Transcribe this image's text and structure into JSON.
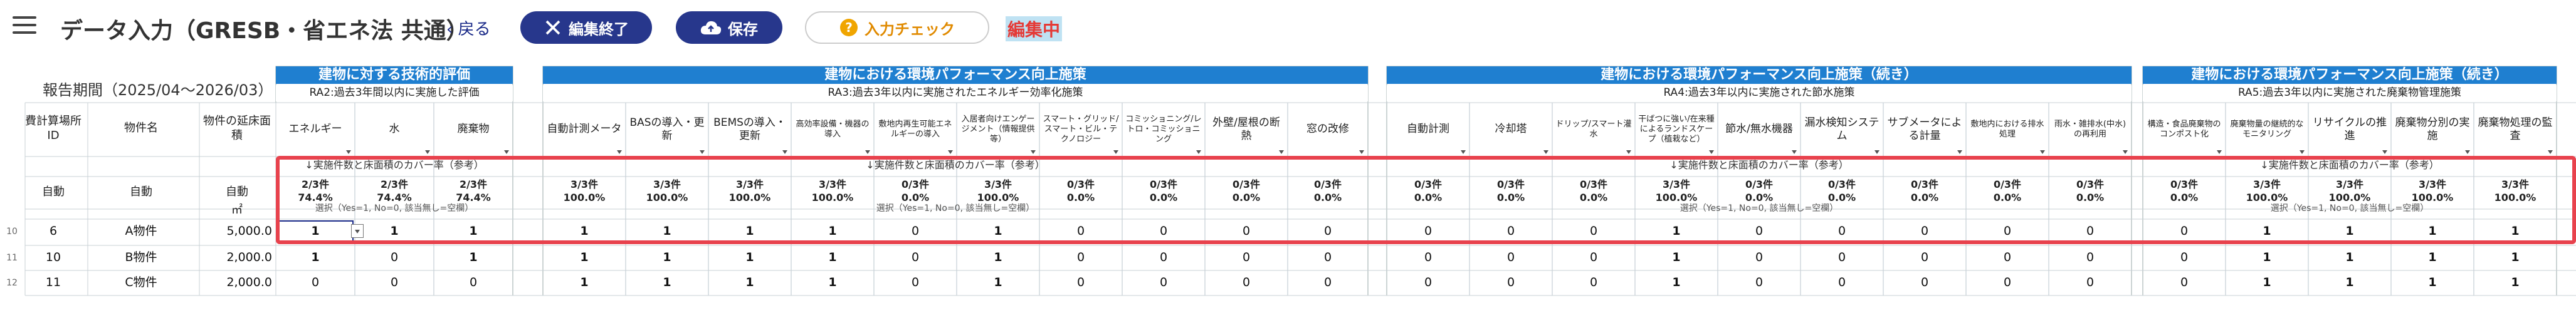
{
  "topbar": {
    "title": "データ入力（GRESB・省エネ法 共通）",
    "back_label": "戻る",
    "end_edit_label": "編集終了",
    "save_label": "保存",
    "check_label": "入力チェック",
    "edit_status": "編集中",
    "accent": "#27378c"
  },
  "sheet": {
    "period": "報告期間（2025/04～2026/03）",
    "left_headers": {
      "id": "費計算場所ID",
      "name": "物件名",
      "area": "物件の延床面積"
    },
    "left_auto": {
      "id": "自動",
      "name": "自動",
      "area": "自動"
    },
    "area_unit": "㎡",
    "sections": [
      {
        "title": "建物に対する技術的評価",
        "subtitle": "RA2:過去3年間以内に実施した評価",
        "note": "↓実施件数と床面積のカバー率（参考）",
        "items": [
          "エネルギー",
          "水",
          "廃棄物"
        ]
      },
      {
        "title": "建物における環境パフォーマンス向上施策",
        "subtitle": "RA3:過去3年以内に実施されたエネルギー効率化施策",
        "note": "↓実施件数と床面積のカバー率（参考）",
        "items": [
          "自動計測メータ",
          "BASの導入・更新",
          "BEMSの導入・更新",
          "高効率設備・機器の導入",
          "敷地内再生可能エネルギーの導入",
          "入居者向けエンゲージメント（情報提供等）",
          "スマート・グリッド/スマート・ビル・テクノロジー",
          "コミッショニング/レトロ・コミッショニング",
          "外壁/屋根の断熱",
          "窓の改修"
        ]
      },
      {
        "title": "建物における環境パフォーマンス向上施策（続き）",
        "subtitle": "RA4:過去3年以内に実施された節水施策",
        "note": "↓実施件数と床面積のカバー率（参考）",
        "items": [
          "自動計測",
          "冷却塔",
          "ドリップ/スマート灌水",
          "干ばつに強い/在来種によるランドスケープ（植栽など）",
          "節水/無水機器",
          "漏水検知システム",
          "サブメータによる計量",
          "敷地内における排水処理",
          "雨水・雑排水(中水)の再利用"
        ]
      },
      {
        "title": "建物における環境パフォーマンス向上施策（続き）",
        "subtitle": "RA5:過去3年以内に実施された廃棄物管理施策",
        "note": "↓実施件数と床面積のカバー率（参考）",
        "items": [
          "構造・食品廃棄物のコンポスト化",
          "廃棄物量の継続的なモニタリング",
          "リサイクルの推進",
          "廃棄物分別の実施",
          "廃棄物処理の監査"
        ]
      }
    ],
    "coverage": [
      [
        "2/3件",
        "2/3件",
        "2/3件"
      ],
      [
        "3/3件",
        "3/3件",
        "3/3件",
        "3/3件",
        "0/3件",
        "3/3件",
        "0/3件",
        "0/3件",
        "0/3件",
        "0/3件"
      ],
      [
        "0/3件",
        "0/3件",
        "0/3件",
        "3/3件",
        "0/3件",
        "0/3件",
        "0/3件",
        "0/3件",
        "0/3件"
      ],
      [
        "0/3件",
        "3/3件",
        "3/3件",
        "3/3件",
        "3/3件"
      ]
    ],
    "coverage_pct": [
      [
        "74.4%",
        "74.4%",
        "74.4%"
      ],
      [
        "100.0%",
        "100.0%",
        "100.0%",
        "100.0%",
        "0.0%",
        "100.0%",
        "0.0%",
        "0.0%",
        "0.0%",
        "0.0%"
      ],
      [
        "0.0%",
        "0.0%",
        "0.0%",
        "100.0%",
        "0.0%",
        "0.0%",
        "0.0%",
        "0.0%",
        "0.0%"
      ],
      [
        "0.0%",
        "100.0%",
        "100.0%",
        "100.0%",
        "100.0%"
      ]
    ],
    "flag_note": "選択（Yes=1, No=0, 該当無し=空欄）",
    "rows": [
      {
        "rownum": "10",
        "id": "6",
        "name": "A物件",
        "area": "5,000.0",
        "values": [
          [
            "1",
            "1",
            "1"
          ],
          [
            "1",
            "1",
            "1",
            "1",
            "0",
            "1",
            "0",
            "0",
            "0",
            "0"
          ],
          [
            "0",
            "0",
            "0",
            "1",
            "0",
            "0",
            "0",
            "0",
            "0"
          ],
          [
            "0",
            "1",
            "1",
            "1",
            "1"
          ]
        ]
      },
      {
        "rownum": "11",
        "id": "10",
        "name": "B物件",
        "area": "2,000.0",
        "values": [
          [
            "1",
            "0",
            "1"
          ],
          [
            "1",
            "1",
            "1",
            "1",
            "0",
            "1",
            "0",
            "0",
            "0",
            "0"
          ],
          [
            "0",
            "0",
            "0",
            "1",
            "0",
            "0",
            "0",
            "0",
            "0"
          ],
          [
            "0",
            "1",
            "1",
            "1",
            "1"
          ]
        ]
      },
      {
        "rownum": "12",
        "id": "11",
        "name": "C物件",
        "area": "2,000.0",
        "values": [
          [
            "0",
            "0",
            "0"
          ],
          [
            "1",
            "1",
            "1",
            "1",
            "0",
            "1",
            "0",
            "0",
            "0",
            "0"
          ],
          [
            "0",
            "0",
            "0",
            "1",
            "0",
            "0",
            "0",
            "0",
            "0"
          ],
          [
            "0",
            "1",
            "1",
            "1",
            "1"
          ]
        ]
      }
    ]
  }
}
